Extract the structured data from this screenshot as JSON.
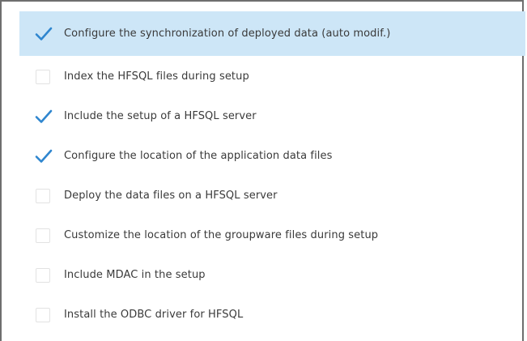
{
  "options": {
    "items": [
      {
        "label": "Configure the synchronization of deployed data (auto modif.)",
        "checked": true,
        "selected": true
      },
      {
        "label": "Index the HFSQL files during setup",
        "checked": false,
        "selected": false
      },
      {
        "label": "Include the setup of a HFSQL server",
        "checked": true,
        "selected": false
      },
      {
        "label": "Configure the location of the application data files",
        "checked": true,
        "selected": false
      },
      {
        "label": "Deploy the data files on a HFSQL server",
        "checked": false,
        "selected": false
      },
      {
        "label": "Customize the location of the groupware files during setup",
        "checked": false,
        "selected": false
      },
      {
        "label": "Include MDAC in the setup",
        "checked": false,
        "selected": false
      },
      {
        "label": "Install the ODBC driver for HFSQL",
        "checked": false,
        "selected": false
      }
    ]
  },
  "colors": {
    "checkmark": "#2f86cf",
    "selection": "#cde6f7",
    "text": "#3a3a3a"
  }
}
